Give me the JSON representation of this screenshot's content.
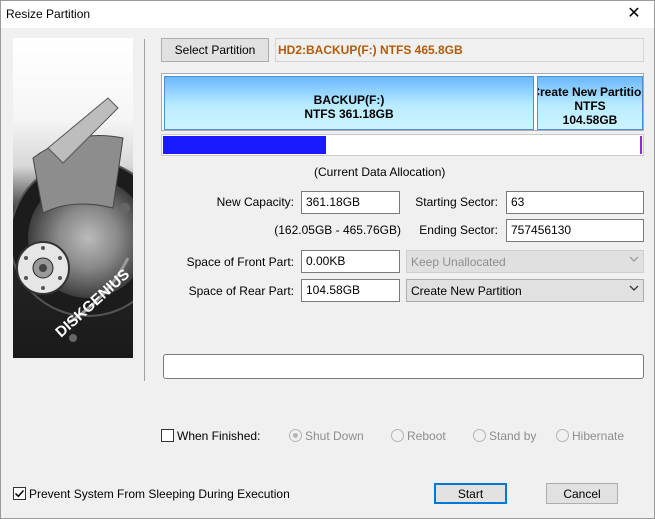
{
  "window": {
    "title": "Resize Partition",
    "close_glyph": "✕"
  },
  "brand": {
    "logo_text": "DISKGENIUS"
  },
  "header": {
    "select_partition_label": "Select Partition",
    "disk_info": "HD2:BACKUP(F:) NTFS 465.8GB",
    "disk_info_color": "#b25b0c"
  },
  "partitions": [
    {
      "name": "BACKUP(F:)",
      "detail": "NTFS 361.18GB"
    },
    {
      "name": "Create New Partition",
      "fs": "NTFS",
      "size": "104.58GB"
    }
  ],
  "allocation": {
    "used_fraction": 0.34,
    "caption": "(Current Data Allocation)",
    "fill_color": "#1a1aff"
  },
  "form": {
    "new_capacity_label": "New Capacity:",
    "new_capacity_value": "361.18GB",
    "range_text": "(162.05GB - 465.76GB)",
    "starting_sector_label": "Starting Sector:",
    "starting_sector_value": "63",
    "ending_sector_label": "Ending Sector:",
    "ending_sector_value": "757456130",
    "front_label": "Space of Front Part:",
    "front_value": "0.00KB",
    "front_action": "Keep Unallocated",
    "rear_label": "Space of Rear Part:",
    "rear_value": "104.58GB",
    "rear_action": "Create New Partition"
  },
  "finish": {
    "when_finished_label": "When Finished:",
    "options": [
      "Shut Down",
      "Reboot",
      "Stand by",
      "Hibernate"
    ],
    "selected": "Shut Down"
  },
  "prevent_sleep": {
    "label": "Prevent System From Sleeping During Execution",
    "checked": true
  },
  "buttons": {
    "start": "Start",
    "cancel": "Cancel"
  }
}
